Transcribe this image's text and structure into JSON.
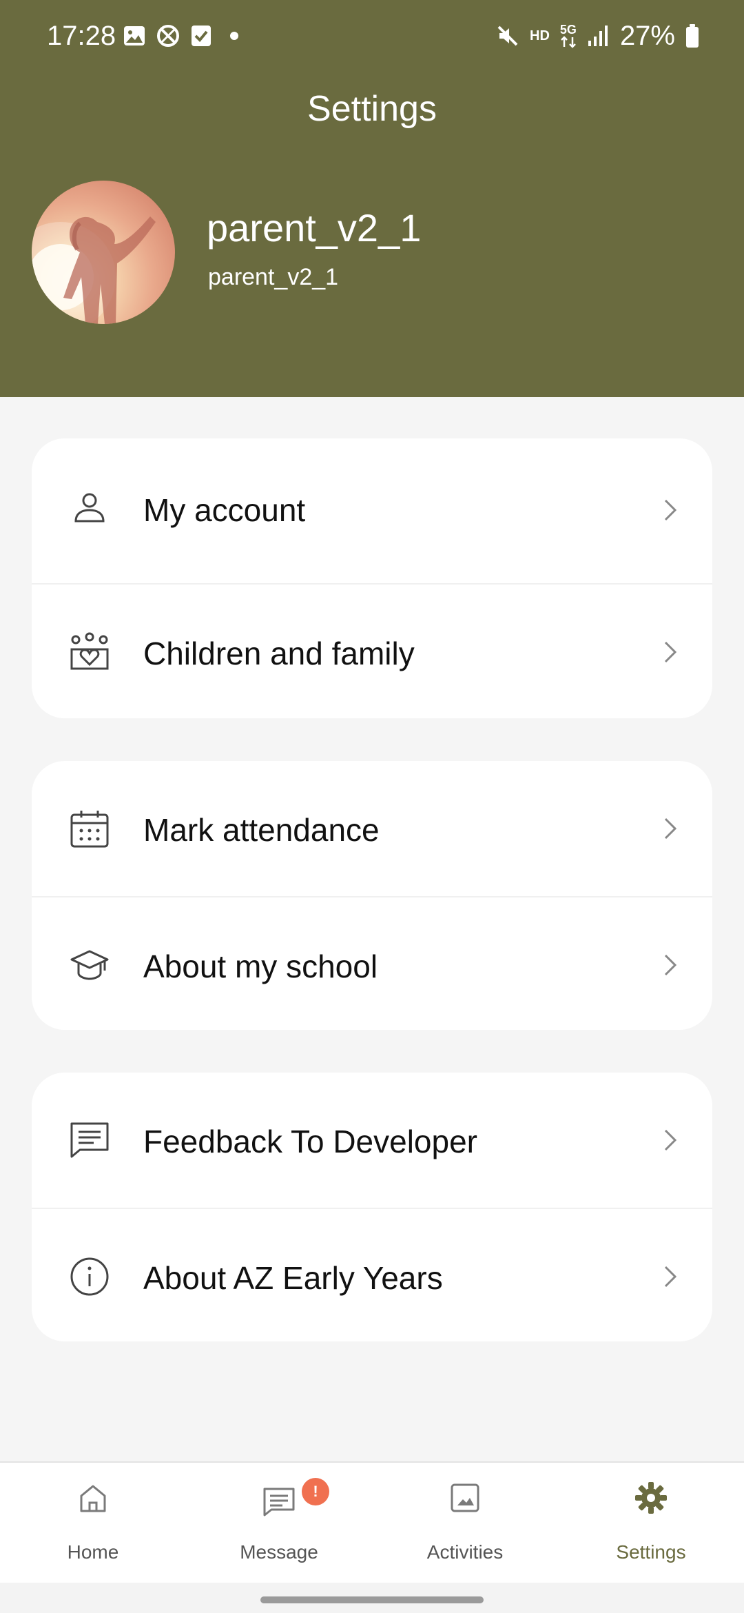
{
  "status_bar": {
    "time": "17:28",
    "left_icons": [
      "image-icon",
      "blocked-icon",
      "check-icon",
      "dot-icon"
    ],
    "right_icons": [
      "mute-icon",
      "hd-badge",
      "5g-signal-icon",
      "cell-signal-icon",
      "battery-icon"
    ],
    "hd": "HD",
    "network": "5G",
    "battery": "27%"
  },
  "header": {
    "title": "Settings",
    "accent_color": "#6a6b3f"
  },
  "profile": {
    "name": "parent_v2_1",
    "username": "parent_v2_1"
  },
  "sections": [
    {
      "items": [
        {
          "label": "My account",
          "icon": "user-icon"
        },
        {
          "label": "Children and family",
          "icon": "family-icon"
        }
      ]
    },
    {
      "items": [
        {
          "label": "Mark attendance",
          "icon": "calendar-icon"
        },
        {
          "label": "About my school",
          "icon": "school-cap-icon"
        }
      ]
    },
    {
      "items": [
        {
          "label": "Feedback To Developer",
          "icon": "message-icon"
        },
        {
          "label": "About AZ Early Years",
          "icon": "info-icon"
        }
      ]
    }
  ],
  "bottom_nav": {
    "items": [
      {
        "label": "Home",
        "icon": "home-icon",
        "active": false
      },
      {
        "label": "Message",
        "icon": "message-icon",
        "active": false,
        "badge": "!"
      },
      {
        "label": "Activities",
        "icon": "image-icon",
        "active": false
      },
      {
        "label": "Settings",
        "icon": "gear-icon",
        "active": true
      }
    ],
    "badge_color": "#f07050"
  }
}
